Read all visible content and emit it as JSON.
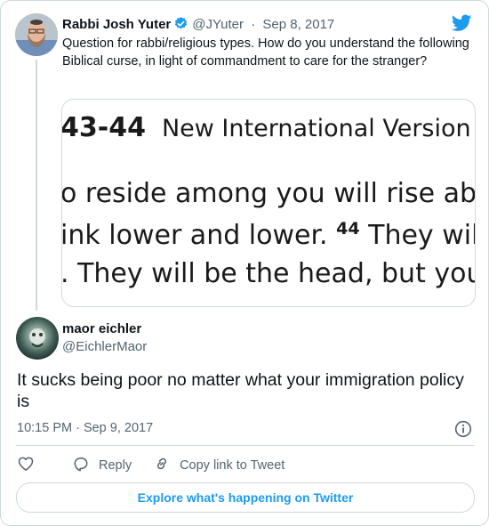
{
  "parent": {
    "name": "Rabbi Josh Yuter",
    "handle": "@JYuter",
    "separator": "·",
    "date": "Sep 8, 2017",
    "text": "Question for rabbi/religious types. How do you understand the following Biblical curse, in light of commandment to care for the stranger?",
    "image": {
      "line1_ref": "43-44",
      "line1_version": "New International Version (",
      "line2": "o reside among you will rise abo",
      "line3a": "ink lower and lower. ",
      "line3_verse": "44",
      "line3b": " They wil",
      "line4": ". They will be the head, but you"
    }
  },
  "reply": {
    "name": "maor eichler",
    "handle": "@EichlerMaor",
    "text": "It sucks being poor no matter what your immigration policy is",
    "timestamp": "10:15 PM · Sep 9, 2017"
  },
  "actions": {
    "reply_label": "Reply",
    "copy_label": "Copy link to Tweet"
  },
  "explore_label": "Explore what's happening on Twitter",
  "colors": {
    "brand": "#1d9bf0",
    "text_primary": "#0f1419",
    "text_secondary": "#536471",
    "border": "#cfd9de"
  },
  "icons": {
    "verified": "verified-badge-icon",
    "logo": "twitter-bird-icon",
    "info": "info-icon",
    "like": "heart-icon",
    "reply": "speech-bubble-icon",
    "copy": "link-icon"
  }
}
